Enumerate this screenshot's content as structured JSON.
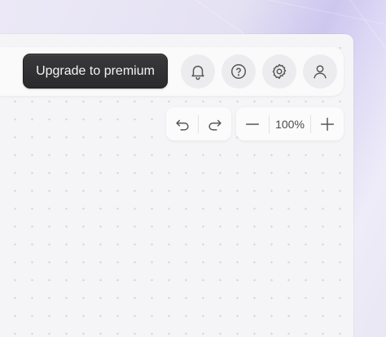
{
  "toolbar": {
    "upgrade_label": "Upgrade to premium"
  },
  "icons": {
    "notifications": "bell-icon",
    "help": "question-circle-icon",
    "settings": "gear-icon",
    "account": "user-icon",
    "undo": "undo-arrow-icon",
    "redo": "redo-arrow-icon",
    "zoom_out": "minus-icon",
    "zoom_in": "plus-icon"
  },
  "zoom": {
    "level": "100%"
  },
  "colors": {
    "upgrade_button": "#2f2f31",
    "canvas_background": "#f5f5f7",
    "canvas_dot": "#d9d9de"
  }
}
